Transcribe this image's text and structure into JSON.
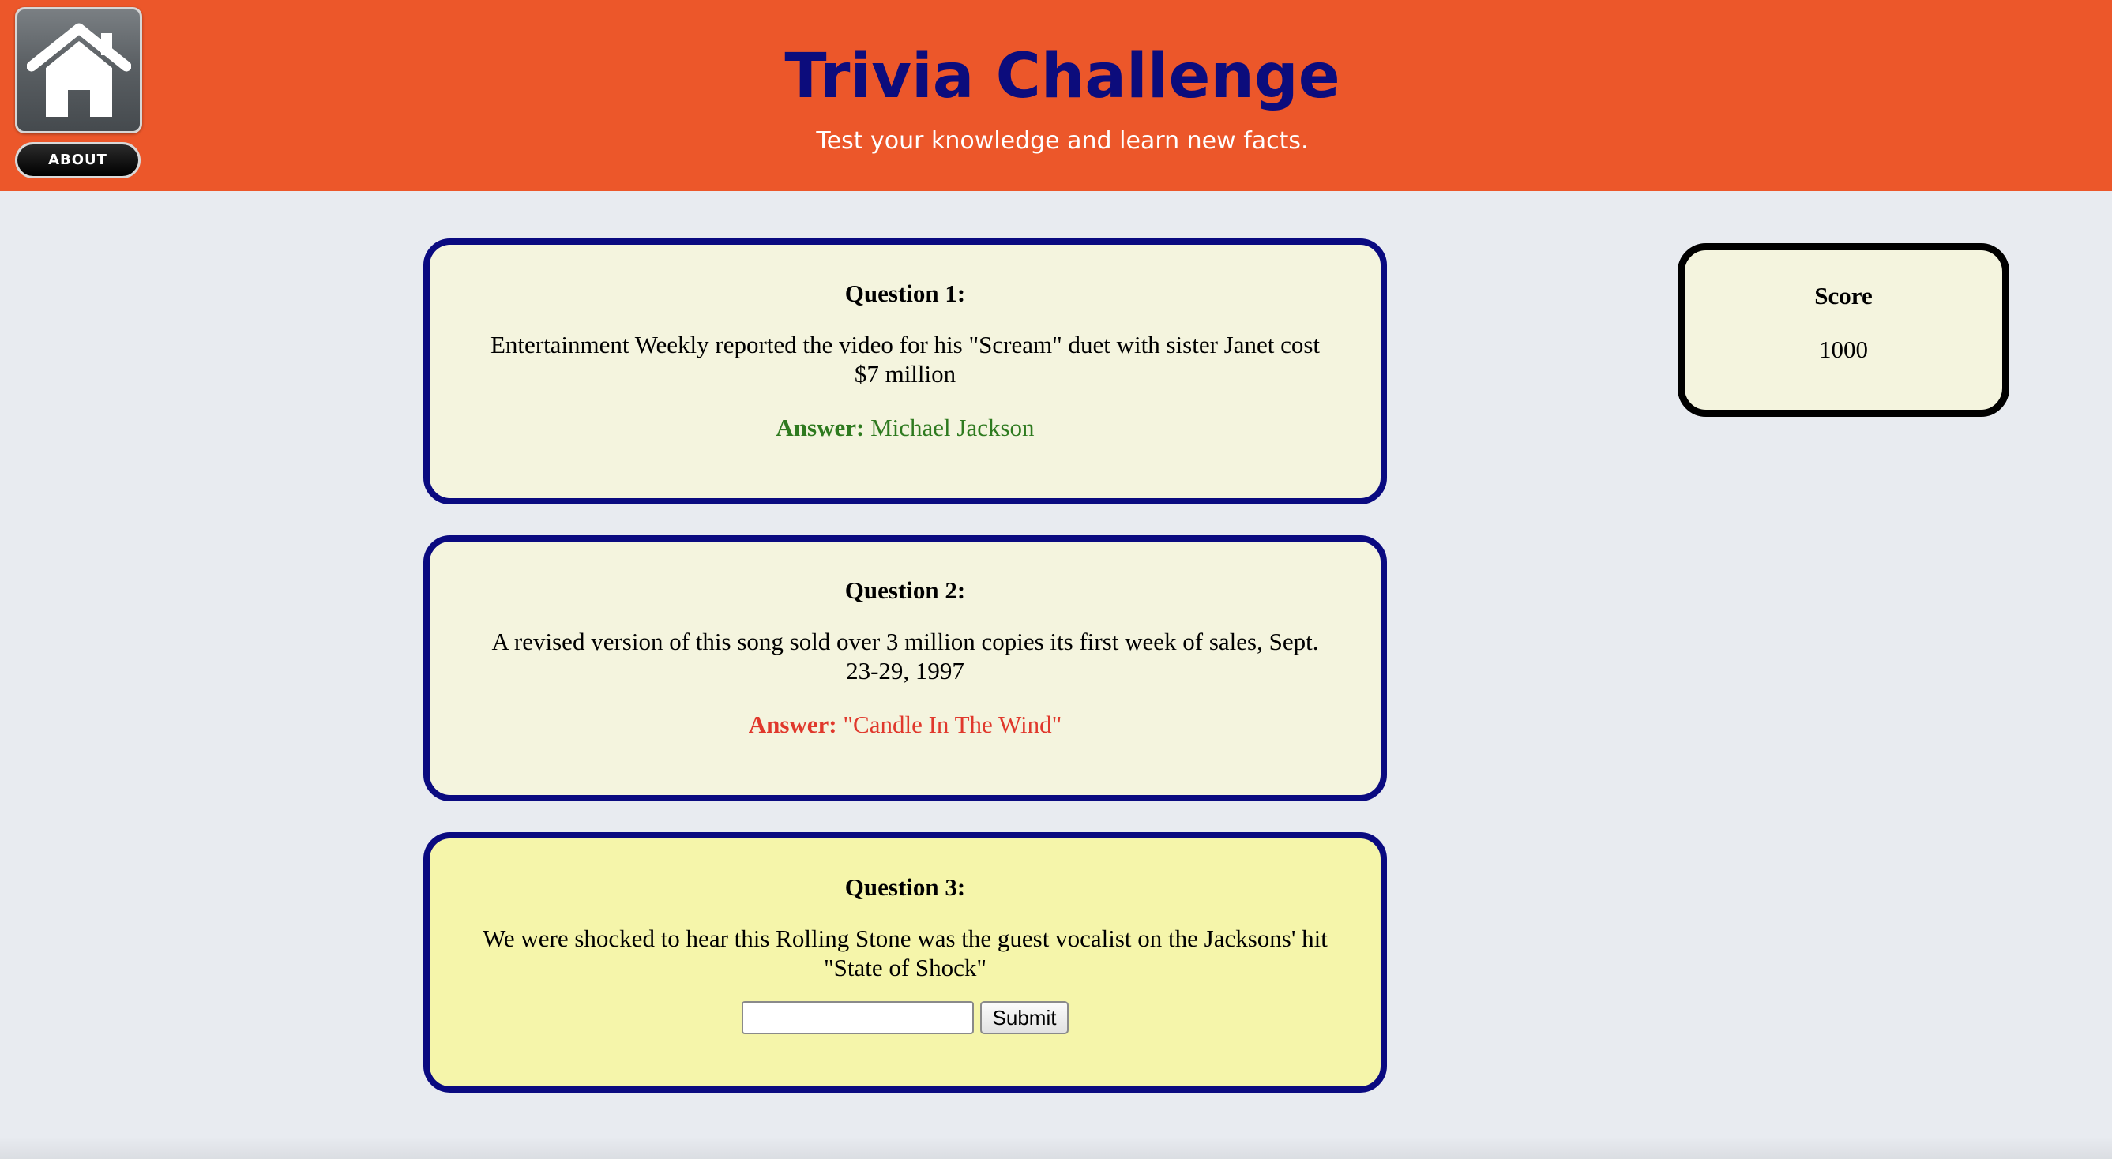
{
  "header": {
    "title": "Trivia Challenge",
    "subtitle": "Test your knowledge and learn new facts.",
    "home_icon": "house-icon",
    "about_label": "ABOUT"
  },
  "colors": {
    "header_bg": "#ec572a",
    "title": "#0c0c7c",
    "card_border": "#0a0a80",
    "card_bg": "#f4f4de",
    "active_card_bg": "#f5f5aa",
    "correct": "#2e7a1f",
    "wrong": "#e0382c",
    "page_bg": "#e8ebf0"
  },
  "questions": [
    {
      "label": "Question 1:",
      "text": "Entertainment Weekly reported the video for his \"Scream\" duet with sister Janet cost $7 million",
      "answer_label": "Answer:",
      "answer": "Michael Jackson",
      "result": "correct"
    },
    {
      "label": "Question 2:",
      "text": "A revised version of this song sold over 3 million copies its first week of sales, Sept. 23-29, 1997",
      "answer_label": "Answer:",
      "answer": "\"Candle In The Wind\"",
      "result": "incorrect"
    },
    {
      "label": "Question 3:",
      "text": "We were shocked to hear this Rolling Stone was the guest vocalist on the Jacksons' hit \"State of Shock\"",
      "input_value": "",
      "submit_label": "Submit"
    }
  ],
  "score": {
    "label": "Score",
    "value": "1000"
  }
}
